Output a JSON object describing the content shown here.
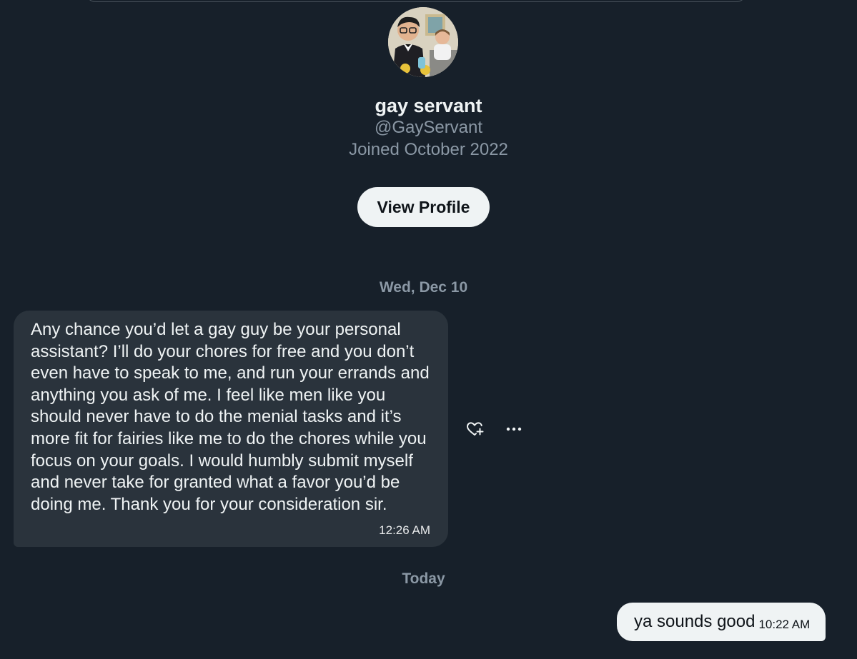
{
  "profile": {
    "display_name": "gay servant",
    "handle": "@GayServant",
    "joined": "Joined October 2022",
    "view_profile_label": "View Profile",
    "avatar_icon": "butler-cleaning-illustration-icon"
  },
  "conversation": {
    "separators": [
      "Wed, Dec 10",
      "Today"
    ],
    "messages": [
      {
        "direction": "incoming",
        "text": "Any chance you’d let a gay guy be your personal\nassistant? I’ll do your chores for free and you don’t\neven have to speak to me, and run your errands and\nanything you ask of me. I feel like men like you\nshould never have to do the menial tasks and it’s\nmore fit for fairies like me to do the chores while you\nfocus on your goals. I would humbly submit myself\nand never take for granted what a favor you’d be\ndoing me. Thank you for your consideration sir.",
        "time": "12:26 AM"
      },
      {
        "direction": "outgoing",
        "text": "ya sounds good",
        "time": "10:22 AM"
      }
    ],
    "message_actions": [
      "heart-plus-icon",
      "more-horizontal-icon"
    ]
  },
  "colors": {
    "background": "#17202a",
    "incoming_bubble": "#2a333c",
    "outgoing_bubble": "#eff3f4",
    "secondary_text": "#8b98a5",
    "primary_text": "#eff3f4"
  }
}
